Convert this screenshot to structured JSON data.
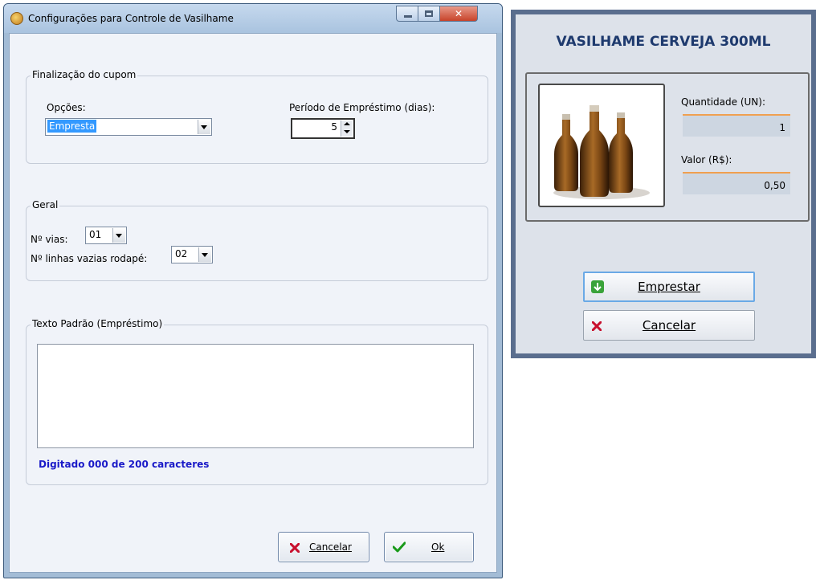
{
  "dialog": {
    "title": "Configurações para Controle de Vasilhame",
    "finalizacao": {
      "group_label": "Finalização do cupom",
      "opcoes_label": "Opções:",
      "opcoes_value": "Empresta",
      "periodo_label": "Período de Empréstimo (dias):",
      "periodo_value": "5"
    },
    "geral": {
      "group_label": "Geral",
      "vias_label": "Nº vias:",
      "vias_value": "01",
      "linhas_label": "Nº linhas vazias rodapé:",
      "linhas_value": "02"
    },
    "texto": {
      "group_label": "Texto Padrão (Empréstimo)",
      "value": "",
      "counter": "Digitado 000 de 200 caracteres"
    },
    "buttons": {
      "cancel_label": "Cancelar",
      "ok_label": "Ok"
    }
  },
  "panel": {
    "title": "VASILHAME CERVEJA 300ML",
    "quantidade_label": "Quantidade (UN):",
    "quantidade_value": "1",
    "valor_label": "Valor (R$):",
    "valor_value": "0,50",
    "emprestar_label": "Emprestar",
    "cancelar_label": "Cancelar"
  },
  "colors": {
    "counter_text": "#1a1ac8",
    "panel_title": "#1e3a6e",
    "selection": "#3399ff",
    "cancel_icon": "#c8102e",
    "ok_icon": "#1a9a1a",
    "emprestar_icon": "#3aa33a"
  },
  "icons": {
    "title": "app-icon",
    "cancel": "x-icon",
    "ok": "checkmark-icon",
    "emprestar": "green-arrow-icon"
  }
}
